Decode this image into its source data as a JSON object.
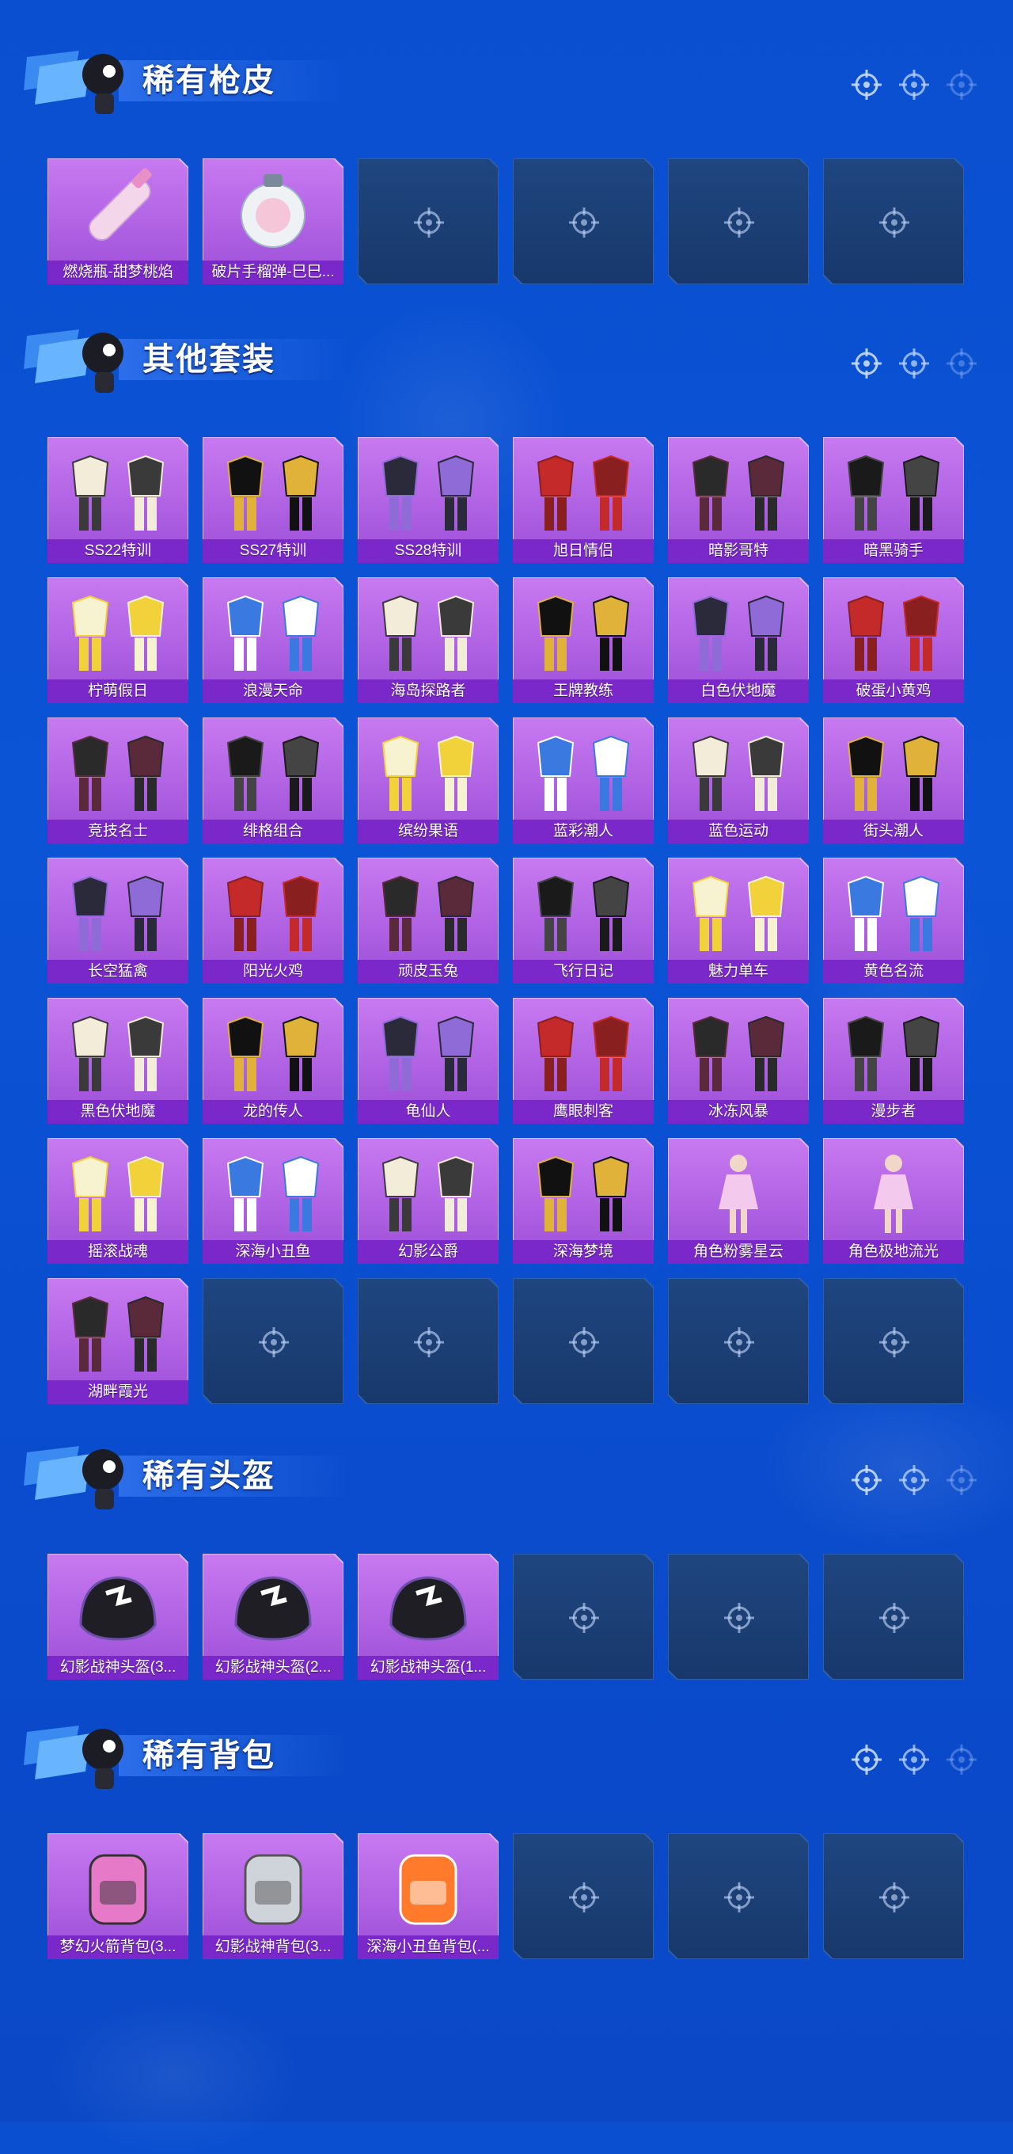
{
  "colors": {
    "accent_purple": "#b35de8",
    "label_purple": "#7a28c9",
    "empty_tile": "#1c3f78",
    "background": "#0a4fd0"
  },
  "sections": [
    {
      "title": "稀有枪皮",
      "items": [
        {
          "label": "燃烧瓶-甜梦桃焰",
          "icon": "molotov-bottle-icon"
        },
        {
          "label": "破片手榴弹-巳巳...",
          "icon": "grenade-icon"
        }
      ],
      "empty_slots": 4
    },
    {
      "title": "其他套装",
      "items": [
        {
          "label": "SS22特训",
          "icon": "outfit-set-icon"
        },
        {
          "label": "SS27特训",
          "icon": "outfit-set-icon"
        },
        {
          "label": "SS28特训",
          "icon": "outfit-set-icon"
        },
        {
          "label": "旭日情侣",
          "icon": "outfit-set-icon"
        },
        {
          "label": "暗影哥特",
          "icon": "outfit-set-icon"
        },
        {
          "label": "暗黑骑手",
          "icon": "outfit-set-icon"
        },
        {
          "label": "柠萌假日",
          "icon": "outfit-set-icon"
        },
        {
          "label": "浪漫天命",
          "icon": "outfit-set-icon"
        },
        {
          "label": "海岛探路者",
          "icon": "outfit-set-icon"
        },
        {
          "label": "王牌教练",
          "icon": "outfit-set-icon"
        },
        {
          "label": "白色伏地魔",
          "icon": "outfit-set-icon"
        },
        {
          "label": "破蛋小黄鸡",
          "icon": "outfit-set-icon"
        },
        {
          "label": "竞技名士",
          "icon": "outfit-set-icon"
        },
        {
          "label": "绯格组合",
          "icon": "outfit-set-icon"
        },
        {
          "label": "缤纷果语",
          "icon": "outfit-set-icon"
        },
        {
          "label": "蓝彩潮人",
          "icon": "outfit-set-icon"
        },
        {
          "label": "蓝色运动",
          "icon": "outfit-set-icon"
        },
        {
          "label": "街头潮人",
          "icon": "outfit-set-icon"
        },
        {
          "label": "长空猛禽",
          "icon": "outfit-set-icon"
        },
        {
          "label": "阳光火鸡",
          "icon": "outfit-set-icon"
        },
        {
          "label": "顽皮玉兔",
          "icon": "outfit-set-icon"
        },
        {
          "label": "飞行日记",
          "icon": "outfit-set-icon"
        },
        {
          "label": "魅力单车",
          "icon": "outfit-set-icon"
        },
        {
          "label": "黄色名流",
          "icon": "outfit-set-icon"
        },
        {
          "label": "黑色伏地魔",
          "icon": "outfit-set-icon"
        },
        {
          "label": "龙的传人",
          "icon": "outfit-set-icon"
        },
        {
          "label": "龟仙人",
          "icon": "outfit-set-icon"
        },
        {
          "label": "鹰眼刺客",
          "icon": "outfit-set-icon"
        },
        {
          "label": "冰冻风暴",
          "icon": "outfit-set-icon"
        },
        {
          "label": "漫步者",
          "icon": "outfit-set-icon"
        },
        {
          "label": "摇滚战魂",
          "icon": "outfit-set-icon"
        },
        {
          "label": "深海小丑鱼",
          "icon": "outfit-set-icon"
        },
        {
          "label": "幻影公爵",
          "icon": "outfit-set-icon"
        },
        {
          "label": "深海梦境",
          "icon": "outfit-set-icon"
        },
        {
          "label": "角色粉雾星云",
          "icon": "character-skin-icon"
        },
        {
          "label": "角色极地流光",
          "icon": "character-skin-icon"
        },
        {
          "label": "湖畔霞光",
          "icon": "outfit-set-icon"
        }
      ],
      "empty_slots": 5
    },
    {
      "title": "稀有头盔",
      "items": [
        {
          "label": "幻影战神头盔(3...",
          "icon": "helmet-icon"
        },
        {
          "label": "幻影战神头盔(2...",
          "icon": "helmet-icon"
        },
        {
          "label": "幻影战神头盔(1...",
          "icon": "helmet-icon"
        }
      ],
      "empty_slots": 3
    },
    {
      "title": "稀有背包",
      "items": [
        {
          "label": "梦幻火箭背包(3...",
          "icon": "backpack-icon"
        },
        {
          "label": "幻影战神背包(3...",
          "icon": "backpack-icon"
        },
        {
          "label": "深海小丑鱼背包(...",
          "icon": "backpack-icon"
        }
      ],
      "empty_slots": 3
    }
  ]
}
